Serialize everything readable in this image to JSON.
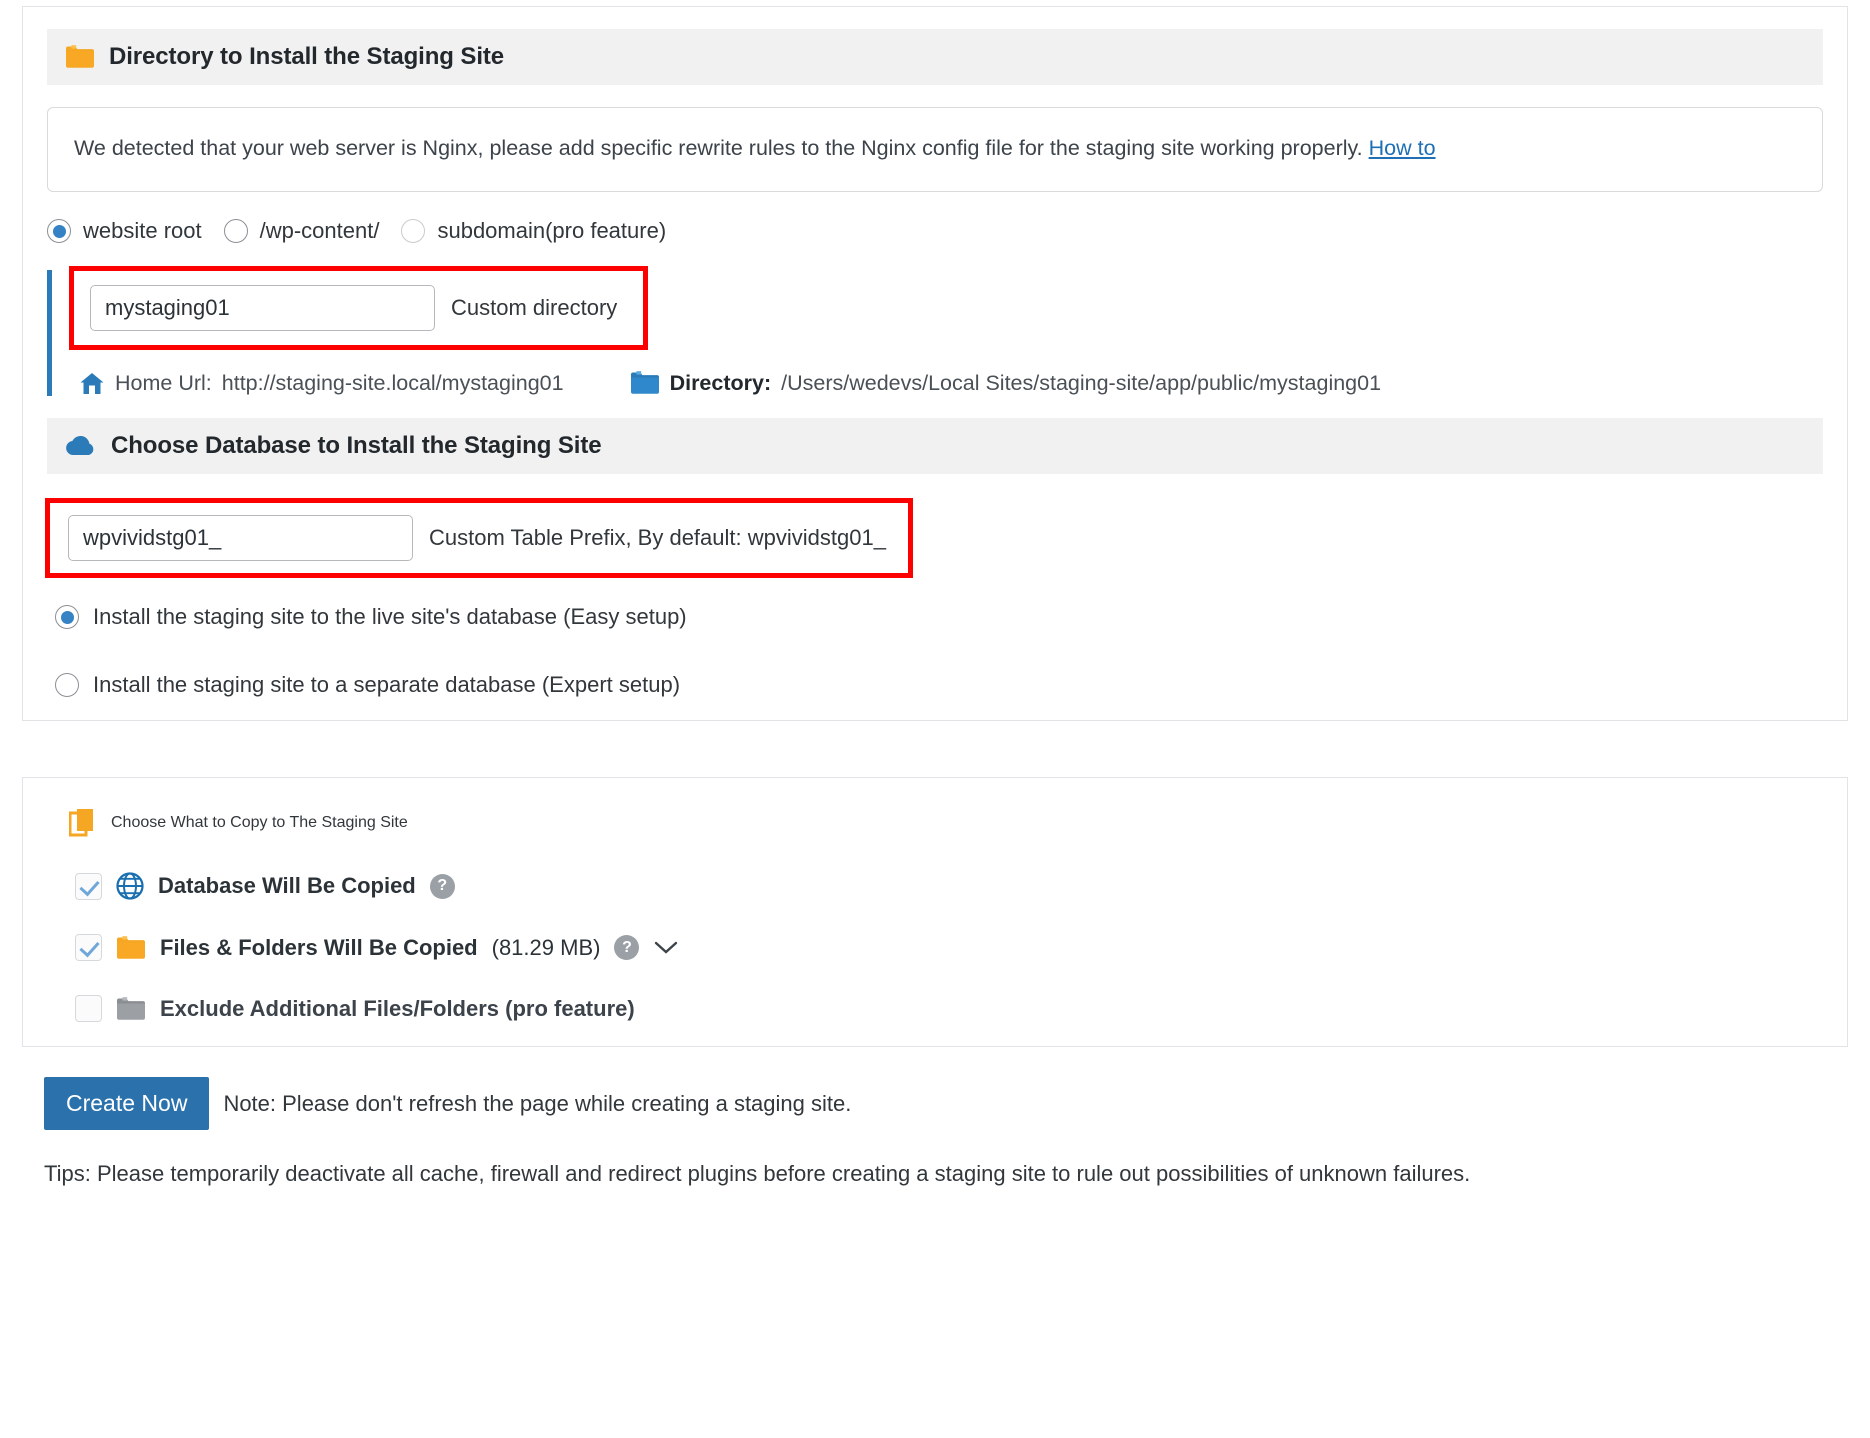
{
  "directory_section": {
    "icon": "folder-open-icon",
    "title": "Directory to Install the Staging Site",
    "notice": {
      "text": "We detected that your web server is Nginx, please add specific rewrite rules to the Nginx config file for the staging site working properly. ",
      "link_label": "How to"
    },
    "location_options": [
      {
        "label": "website root",
        "selected": true,
        "disabled": false
      },
      {
        "label": "/wp-content/",
        "selected": false,
        "disabled": false
      },
      {
        "label": "subdomain(pro feature)",
        "selected": false,
        "disabled": true
      }
    ],
    "custom_directory": {
      "value": "mystaging01",
      "placeholder": "mystaging01",
      "hint": "Custom directory"
    },
    "home_url_label": "Home Url:",
    "home_url_value": "http://staging-site.local/mystaging01",
    "directory_label": "Directory:",
    "directory_value": "/Users/wedevs/Local Sites/staging-site/app/public/mystaging01"
  },
  "database_section": {
    "icon": "cloud-icon",
    "title": "Choose Database to Install the Staging Site",
    "table_prefix": {
      "value": "wpvividstg01_",
      "placeholder": "wpvividstg01_",
      "hint": "Custom Table Prefix, By default: wpvividstg01_"
    },
    "options": [
      {
        "label": "Install the staging site to the live site's database (Easy setup)",
        "selected": true
      },
      {
        "label": "Install the staging site to a separate database (Expert setup)",
        "selected": false
      }
    ]
  },
  "copy_section": {
    "icon": "copy-icon",
    "title": "Choose What to Copy to The Staging Site",
    "items": [
      {
        "icon": "globe-icon",
        "label": "Database Will Be Copied",
        "size": "",
        "checked": true,
        "disabled": false,
        "help": "?",
        "has_chevron": false
      },
      {
        "icon": "folder-open-icon",
        "label": "Files & Folders Will Be Copied",
        "size": "(81.29 MB)",
        "checked": true,
        "disabled": false,
        "help": "?",
        "has_chevron": true
      },
      {
        "icon": "folder-muted-icon",
        "label": "Exclude Additional Files/Folders (pro feature)",
        "size": "",
        "checked": false,
        "disabled": true,
        "help": "",
        "has_chevron": false
      }
    ]
  },
  "footer": {
    "create_button": "Create Now",
    "note": "Note: Please don't refresh the page while creating a staging site.",
    "tips": "Tips: Please temporarily deactivate all cache, firewall and redirect plugins before creating a staging site to rule out possibilities of unknown failures."
  },
  "colors": {
    "accent_blue": "#2b72ad",
    "highlight_red": "#fd0000",
    "folder_orange": "#f5a623",
    "header_grey": "#f1f1f1"
  }
}
